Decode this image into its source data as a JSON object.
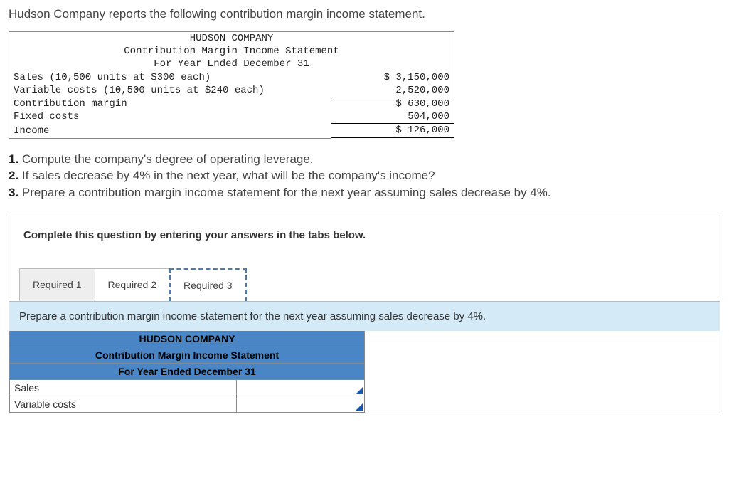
{
  "intro": "Hudson Company reports the following contribution margin income statement.",
  "statement": {
    "company": "HUDSON COMPANY",
    "title": "Contribution Margin Income Statement",
    "period": "For Year Ended December 31",
    "rows": {
      "sales_label": "Sales (10,500 units at $300 each)",
      "sales_value": "$ 3,150,000",
      "varcost_label": "Variable costs (10,500 units at $240 each)",
      "varcost_value": "2,520,000",
      "cm_label": "Contribution margin",
      "cm_value": "$ 630,000",
      "fixed_label": "Fixed costs",
      "fixed_value": "504,000",
      "income_label": "Income",
      "income_value": "$ 126,000"
    }
  },
  "questions": {
    "q1": "Compute the company's degree of operating leverage.",
    "q2": "If sales decrease by 4% in the next year, what will be the company's income?",
    "q3": "Prepare a contribution margin income statement for the next year assuming sales decrease by 4%."
  },
  "instruction": "Complete this question by entering your answers in the tabs below.",
  "tabs": {
    "t1": "Required 1",
    "t2": "Required 2",
    "t3": "Required 3"
  },
  "tab3": {
    "prompt": "Prepare a contribution margin income statement for the next year assuming sales decrease by 4%.",
    "company": "HUDSON COMPANY",
    "title": "Contribution Margin Income Statement",
    "period": "For Year Ended December 31",
    "rows": {
      "sales_label": "Sales",
      "varcost_label": "Variable costs"
    }
  },
  "chart_data": {
    "type": "table",
    "title": "HUDSON COMPANY Contribution Margin Income Statement, For Year Ended December 31",
    "rows": [
      {
        "label": "Sales (10,500 units at $300 each)",
        "value": 3150000
      },
      {
        "label": "Variable costs (10,500 units at $240 each)",
        "value": 2520000
      },
      {
        "label": "Contribution margin",
        "value": 630000
      },
      {
        "label": "Fixed costs",
        "value": 504000
      },
      {
        "label": "Income",
        "value": 126000
      }
    ]
  }
}
